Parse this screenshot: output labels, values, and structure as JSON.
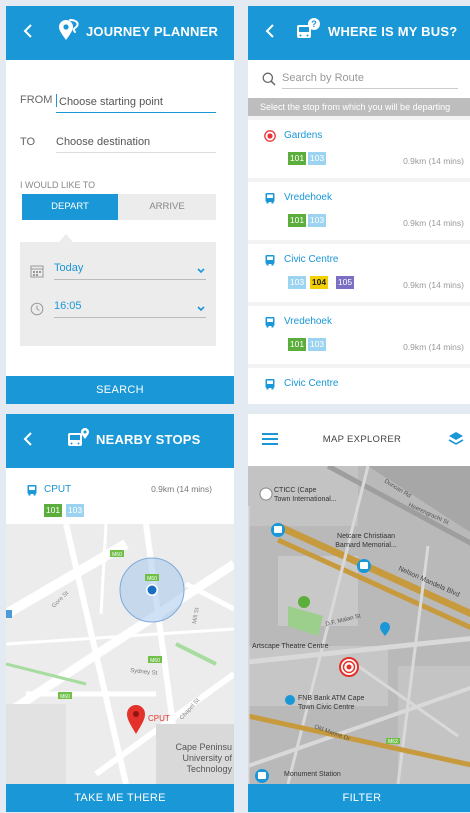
{
  "journey_planner": {
    "title": "JOURNEY PLANNER",
    "from_label": "FROM",
    "from_placeholder": "Choose starting point",
    "to_label": "TO",
    "to_placeholder": "Choose destination",
    "would_like_label": "I WOULD LIKE TO",
    "depart_label": "DEPART",
    "arrive_label": "ARRIVE",
    "day_value": "Today",
    "time_value": "16:05",
    "search_label": "SEARCH"
  },
  "where_is_my_bus": {
    "title": "WHERE IS MY BUS?",
    "search_placeholder": "Search by Route",
    "hint": "Select the stop from which you will be departing",
    "stops": [
      {
        "name": "Gardens",
        "routes": [
          "101",
          "103"
        ],
        "distance": "0.9km (14 mins)"
      },
      {
        "name": "Vredehoek",
        "routes": [
          "101",
          "103"
        ],
        "distance": "0.9km (14 mins)"
      },
      {
        "name": "Civic Centre",
        "routes": [
          "103",
          "104",
          "105"
        ],
        "distance": "0.9km (14 mins)"
      },
      {
        "name": "Vredehoek",
        "routes": [
          "101",
          "103"
        ],
        "distance": "0.9km (14 mins)"
      },
      {
        "name": "Civic Centre"
      }
    ]
  },
  "nearby_stops": {
    "title": "NEARBY STOPS",
    "stop_name": "CPUT",
    "distance": "0.9km (14 mins)",
    "routes": [
      "101",
      "103"
    ],
    "map_labels": {
      "gore": "Gore St",
      "mill": "Mill St",
      "sydney": "Sydney St",
      "chapel": "Chapel St",
      "pin": "CPUT",
      "uni1": "Cape Peninsu",
      "uni2": "University of",
      "uni3": "Technology",
      "badge1": "M60",
      "badge2": "M60",
      "badge3": "M60",
      "badge4": "M60"
    },
    "action_label": "TAKE ME THERE"
  },
  "map_explorer": {
    "title": "MAP EXPLORER",
    "labels": {
      "ctich1": "CTICC (Cape",
      "ctich2": "Town International...",
      "duncan": "Duncan Rd",
      "heerengracht": "Heerengracht St",
      "netcare1": "Netcare Christiaan",
      "netcare2": "Barnard Memorial...",
      "nelson": "Nelson Mandela Blvd",
      "malan": "D.F. Malan St",
      "artscape": "Artscape Theatre Centre",
      "fnb1": "FNB Bank ATM Cape",
      "fnb2": "Town Civic Centre",
      "old_marine": "Old Marine Dr",
      "monument": "Monument Station",
      "badge": "M62"
    },
    "filter_label": "FILTER"
  },
  "colors": {
    "accent": "#1a97d6",
    "route_101": "#5cae3c",
    "route_103": "#9bd3f0",
    "route_104": "#f4d000",
    "route_105": "#7b6fc4",
    "gardens_icon": "#e8343c"
  }
}
